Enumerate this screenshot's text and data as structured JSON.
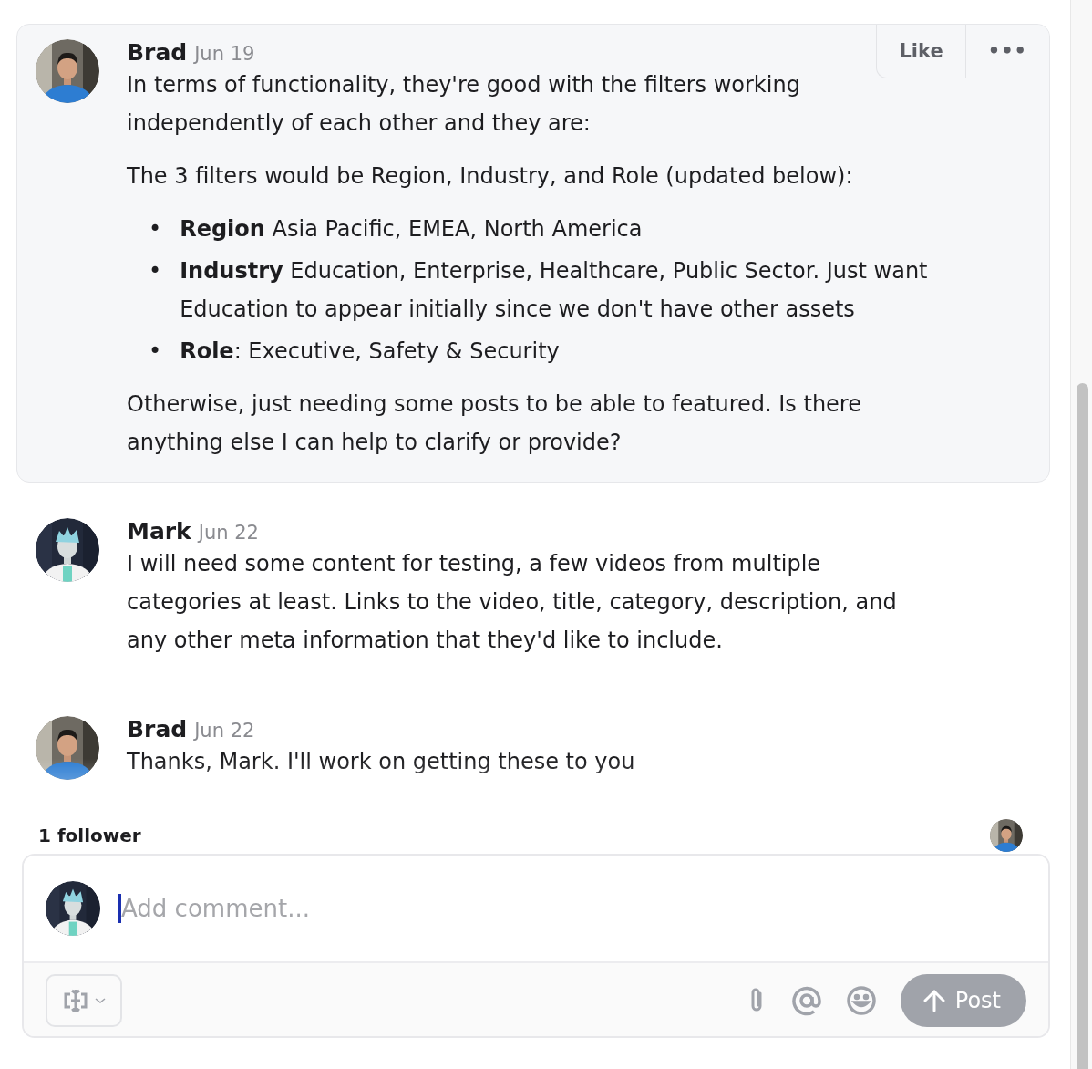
{
  "comments": [
    {
      "author": "Brad",
      "date": "Jun 19",
      "highlighted": true,
      "actions": [
        {
          "kind": "like",
          "label": "Like"
        },
        {
          "kind": "more",
          "label": "•••"
        }
      ],
      "blocks": [
        {
          "kind": "text",
          "text": "In terms of functionality, they're good with the filters working independently of each other and they are:"
        },
        {
          "kind": "text",
          "text": "The 3 filters would be Region, Industry, and Role (updated below):"
        },
        {
          "kind": "list",
          "bullet": "•",
          "items": [
            "**Region** Asia Pacific, EMEA, North America",
            "**Industry** Education, Enterprise, Healthcare, Public Sector. Just want Education to appear initially since we don't have other assets",
            "**Role**: Executive, Safety & Security"
          ]
        },
        {
          "kind": "text",
          "text": "Otherwise, just needing some posts to be able to featured. Is there anything else I can help to clarify or provide?"
        }
      ]
    },
    {
      "author": "Mark",
      "date": "Jun 22",
      "highlighted": false,
      "blocks": [
        {
          "kind": "text",
          "text": "I will need some content for testing, a few videos from multiple categories at least. Links to the video, title, category, description, and any other meta information that they'd like to include."
        }
      ]
    },
    {
      "author": "Brad",
      "date": "Jun 22",
      "highlighted": false,
      "blocks": [
        {
          "kind": "text",
          "text": "Thanks, Mark. I'll work on getting these to you"
        }
      ]
    }
  ],
  "followers": {
    "label": "1 follower"
  },
  "composer": {
    "placeholder": "Add comment...",
    "post": "Post"
  }
}
